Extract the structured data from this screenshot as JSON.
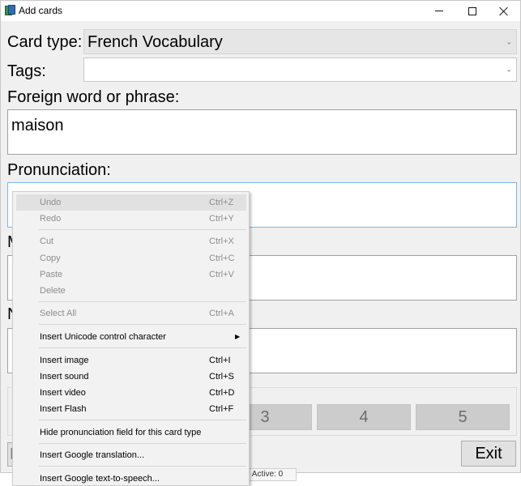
{
  "window": {
    "title": "Add cards"
  },
  "form": {
    "card_type_label": "Card type:",
    "card_type_value": "French Vocabulary",
    "tags_label": "Tags:",
    "tags_value": "",
    "foreign_label": "Foreign word or phrase:",
    "foreign_value": "maison",
    "pronunciation_label": "Pronunciation:",
    "meaning_label_partial": "M",
    "notes_label_partial": "N"
  },
  "grades": {
    "buttons": [
      "3",
      "4",
      "5"
    ]
  },
  "bottom": {
    "exit_label": "Exit",
    "left_button_partial": "P",
    "status_text": "0   Active: 0"
  },
  "context_menu": {
    "items": [
      {
        "label": "Undo",
        "shortcut": "Ctrl+Z",
        "enabled": false,
        "highlighted": true
      },
      {
        "label": "Redo",
        "shortcut": "Ctrl+Y",
        "enabled": false
      },
      {
        "label": "Cut",
        "shortcut": "Ctrl+X",
        "enabled": false
      },
      {
        "label": "Copy",
        "shortcut": "Ctrl+C",
        "enabled": false
      },
      {
        "label": "Paste",
        "shortcut": "Ctrl+V",
        "enabled": false
      },
      {
        "label": "Delete",
        "shortcut": "",
        "enabled": false
      },
      {
        "label": "Select All",
        "shortcut": "Ctrl+A",
        "enabled": false
      },
      {
        "label": "Insert Unicode control character",
        "shortcut": "",
        "enabled": true,
        "submenu": true
      },
      {
        "label": "Insert image",
        "shortcut": "Ctrl+I",
        "enabled": true
      },
      {
        "label": "Insert sound",
        "shortcut": "Ctrl+S",
        "enabled": true
      },
      {
        "label": "Insert video",
        "shortcut": "Ctrl+D",
        "enabled": true
      },
      {
        "label": "Insert Flash",
        "shortcut": "Ctrl+F",
        "enabled": true
      },
      {
        "label": "Hide pronunciation field for this card type",
        "shortcut": "",
        "enabled": true
      },
      {
        "label": "Insert Google translation...",
        "shortcut": "",
        "enabled": true
      },
      {
        "label": "Insert Google text-to-speech...",
        "shortcut": "",
        "enabled": true
      }
    ]
  }
}
